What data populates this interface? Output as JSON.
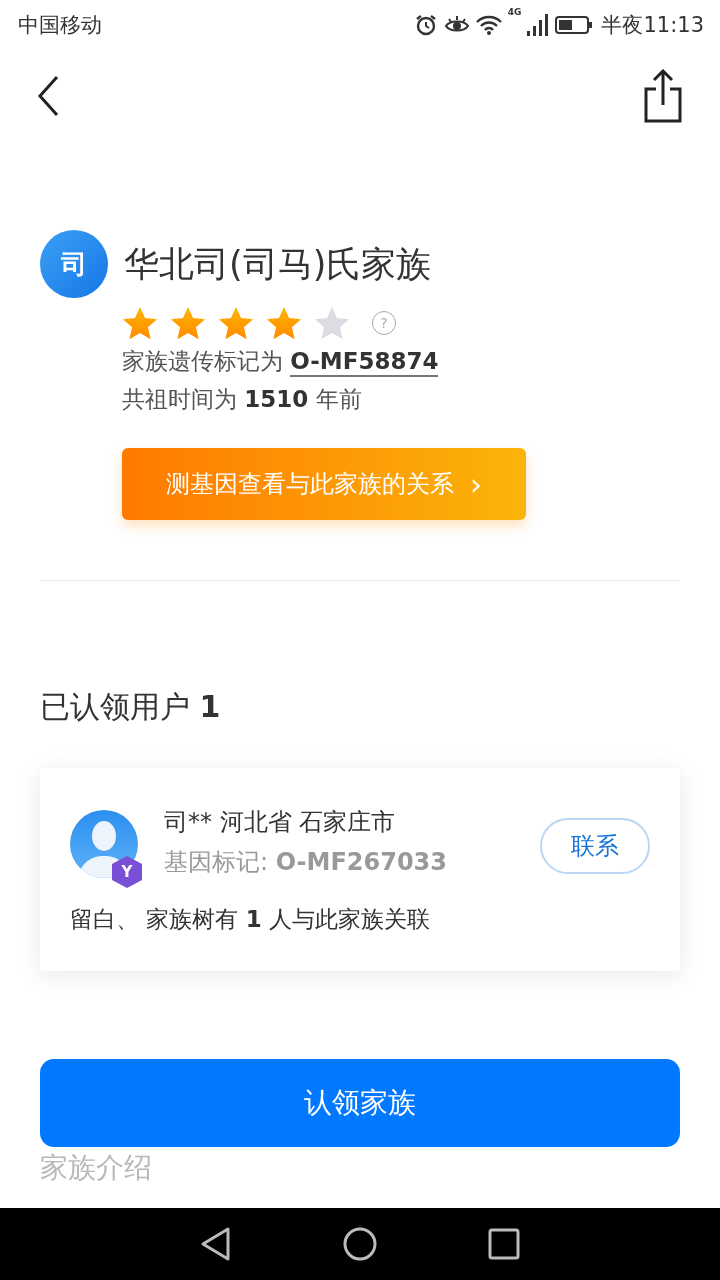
{
  "status_bar": {
    "carrier": "中国移动",
    "network": "4G",
    "time": "半夜11:13"
  },
  "family": {
    "avatar_char": "司",
    "title": "华北司(司马)氏家族",
    "stars": 4,
    "help": "?",
    "marker_label": "家族遗传标记为",
    "marker": "O-MF58874",
    "ancestor": "共祖时间为 **1510** 年前",
    "cta": "测基因查看与此家族的关系",
    "cta_arrow": "›"
  },
  "claimed": {
    "heading": "已认领用户 **1**",
    "users": [
      {
        "badge": "Y",
        "name": "司** 河北省 石家庄市",
        "gene": "基因标记: **O-MF267033**",
        "contact": "联系",
        "note": "留白、 家族树有 **1** 人与此家族关联"
      }
    ]
  },
  "claim_button": "认领家族",
  "next_section": "家族介绍"
}
